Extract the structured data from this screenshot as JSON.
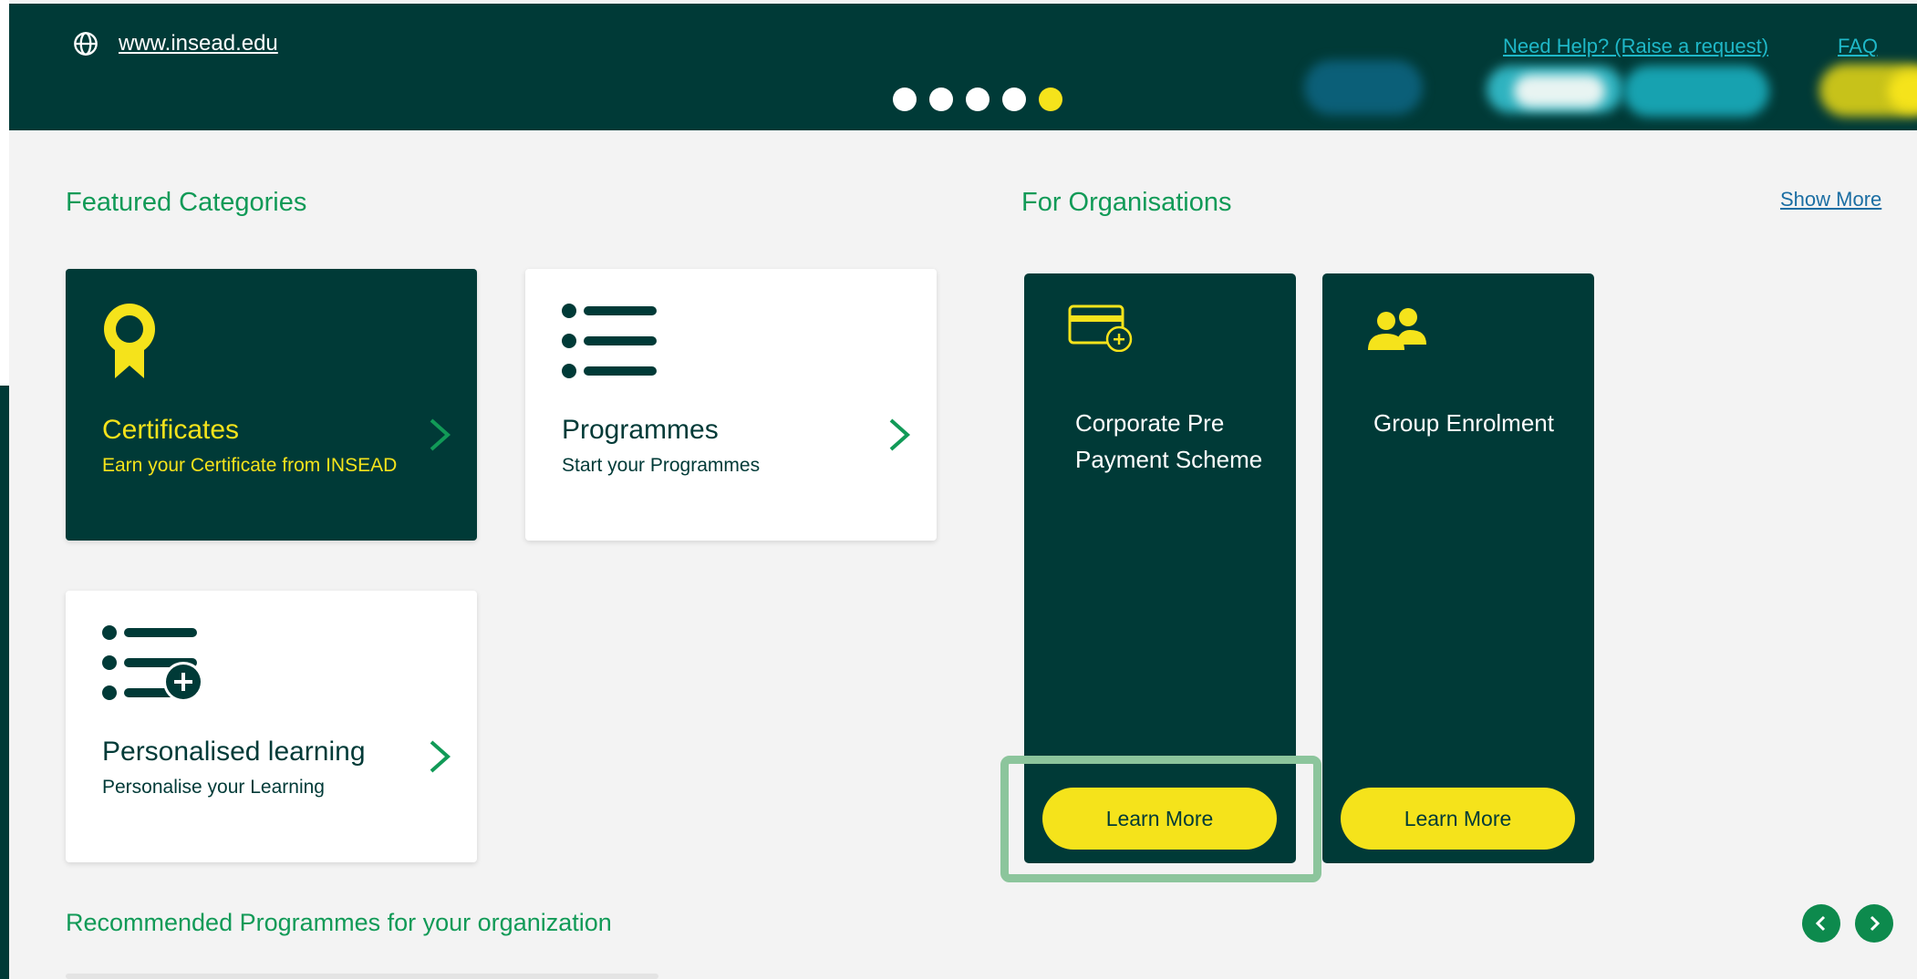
{
  "header": {
    "site_link": "www.insead.edu",
    "help_link": "Need Help? (Raise a request)",
    "faq_link": "FAQ",
    "carousel_dots": 5,
    "active_dot": 5
  },
  "featured": {
    "title": "Featured Categories",
    "cards": [
      {
        "title": "Certificates",
        "subtitle": "Earn your Certificate from INSEAD"
      },
      {
        "title": "Programmes",
        "subtitle": "Start your Programmes"
      },
      {
        "title": "Personalised learning",
        "subtitle": "Personalise your Learning"
      }
    ]
  },
  "organisations": {
    "title": "For Organisations",
    "show_more": "Show More",
    "cards": [
      {
        "title": "Corporate Pre Payment Scheme",
        "button": "Learn More",
        "icon": "credit-card-plus-icon"
      },
      {
        "title": "Group Enrolment",
        "button": "Learn More",
        "icon": "users-icon"
      }
    ]
  },
  "recommended": {
    "title": "Recommended Programmes for your organization"
  },
  "colors": {
    "brand_dark": "#003a37",
    "accent_yellow": "#f5e31b",
    "brand_green": "#119a57",
    "link_cyan": "#1fb8c8",
    "highlight": "#8cc59c"
  }
}
